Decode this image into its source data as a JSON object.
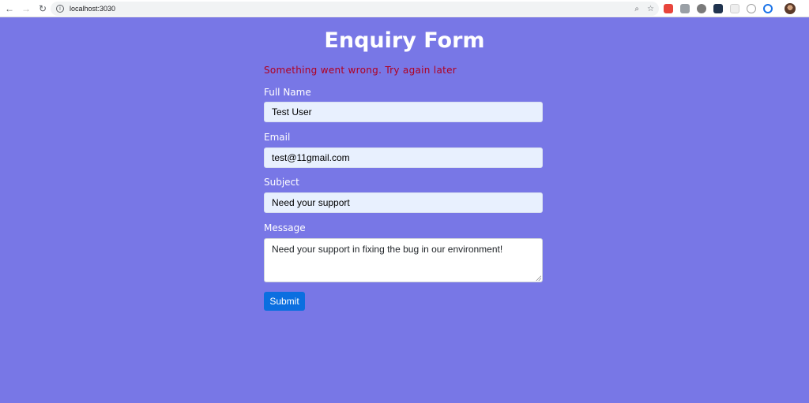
{
  "browser": {
    "url": "localhost:3030",
    "nav": {
      "back": "←",
      "forward": "→",
      "reload": "↻",
      "info": "i"
    },
    "omnibox_icons": {
      "zoom": "⌕",
      "bookmark": "☆"
    },
    "extensions": [
      {
        "name": "extension-1-icon",
        "color": "#e8453c"
      },
      {
        "name": "extension-2-icon",
        "color": "#9aa0a6"
      },
      {
        "name": "extension-3-icon",
        "color": "#7a7a7a"
      },
      {
        "name": "extension-4-icon",
        "color": "#20344f"
      },
      {
        "name": "extension-5-icon",
        "color": "#d0d0d0"
      },
      {
        "name": "extension-6-icon",
        "color": "#c9c9c9"
      },
      {
        "name": "extension-7-icon",
        "color": "#1a73e8"
      }
    ],
    "menu": "⋮"
  },
  "page": {
    "title": "Enquiry Form",
    "error": "Something went wrong. Try again later",
    "background": "#7877e6",
    "fields": {
      "full_name": {
        "label": "Full Name",
        "value": "Test User"
      },
      "email": {
        "label": "Email",
        "value": "test@11gmail.com"
      },
      "subject": {
        "label": "Subject",
        "value": "Need your support"
      },
      "message": {
        "label": "Message",
        "value": "Need your support in fixing the bug in our environment!"
      }
    },
    "submit_label": "Submit",
    "accent": "#0b6fe0",
    "error_color": "#b00020"
  }
}
